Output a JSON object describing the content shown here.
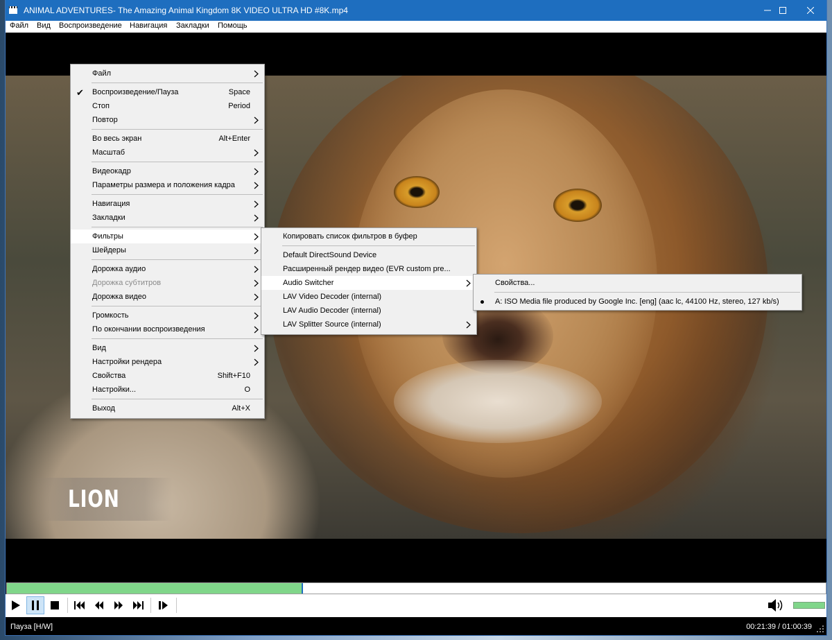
{
  "window": {
    "title": "ANIMAL ADVENTURES- The Amazing Animal Kingdom 8K VIDEO ULTRA HD #8K.mp4"
  },
  "menubar": [
    "Файл",
    "Вид",
    "Воспроизведение",
    "Навигация",
    "Закладки",
    "Помощь"
  ],
  "video": {
    "caption": "LION"
  },
  "main_menu": {
    "items": [
      {
        "label": "Файл",
        "submenu": true
      },
      {
        "label": "Воспроизведение/Пауза",
        "shortcut": "Space",
        "checked": true
      },
      {
        "label": "Стоп",
        "shortcut": "Period"
      },
      {
        "label": "Повтор",
        "submenu": true
      },
      {
        "label": "Во весь экран",
        "shortcut": "Alt+Enter"
      },
      {
        "label": "Масштаб",
        "submenu": true
      },
      {
        "label": "Видеокадр",
        "submenu": true
      },
      {
        "label": "Параметры размера и положения кадра",
        "submenu": true
      },
      {
        "label": "Навигация",
        "submenu": true
      },
      {
        "label": "Закладки",
        "submenu": true
      },
      {
        "label": "Фильтры",
        "submenu": true,
        "highlighted": true
      },
      {
        "label": "Шейдеры",
        "submenu": true
      },
      {
        "label": "Дорожка аудио",
        "submenu": true
      },
      {
        "label": "Дорожка субтитров",
        "submenu": true,
        "disabled": true
      },
      {
        "label": "Дорожка видео",
        "submenu": true
      },
      {
        "label": "Громкость",
        "submenu": true
      },
      {
        "label": "По окончании воспроизведения",
        "submenu": true
      },
      {
        "label": "Вид",
        "submenu": true
      },
      {
        "label": "Настройки рендера",
        "submenu": true
      },
      {
        "label": "Свойства",
        "shortcut": "Shift+F10"
      },
      {
        "label": "Настройки...",
        "shortcut": "O"
      },
      {
        "label": "Выход",
        "shortcut": "Alt+X"
      }
    ]
  },
  "filters_menu": {
    "items": [
      {
        "label": "Копировать список фильтров в буфер"
      },
      {
        "label": "Default DirectSound Device"
      },
      {
        "label": "Расширенный рендер видео (EVR custom pre..."
      },
      {
        "label": "Audio Switcher",
        "submenu": true,
        "highlighted": true
      },
      {
        "label": "LAV Video Decoder (internal)"
      },
      {
        "label": "LAV Audio Decoder (internal)"
      },
      {
        "label": "LAV Splitter Source (internal)",
        "submenu": true
      }
    ]
  },
  "audio_switcher_menu": {
    "items": [
      {
        "label": "Свойства..."
      },
      {
        "label": "A: ISO Media file produced by Google Inc. [eng] (aac lc, 44100 Hz, stereo, 127 kb/s)",
        "selected": true
      }
    ]
  },
  "playback": {
    "progress": 0.36,
    "volume": 1.0,
    "status": "Пауза [H/W]",
    "time": "00:21:39 / 01:00:39"
  },
  "icons": {
    "play": "play-icon",
    "pause": "pause-icon",
    "stop": "stop-icon",
    "prev": "skip-previous-icon",
    "rewind": "rewind-icon",
    "forward": "fast-forward-icon",
    "next": "skip-next-icon",
    "frame_step": "frame-step-icon",
    "volume": "speaker-icon"
  },
  "colors": {
    "titlebar": "#1e6ebf",
    "progress_fill": "#80d68a",
    "accent": "#1e6ebf"
  }
}
